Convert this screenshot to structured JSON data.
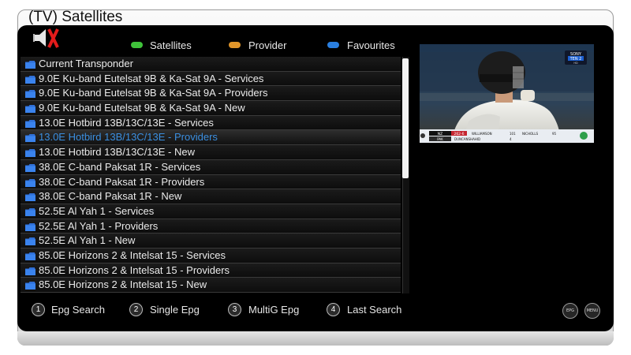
{
  "header": {
    "title": "(TV) Satellites"
  },
  "legend": {
    "satellites": {
      "label": "Satellites",
      "color": "#3fc23a"
    },
    "provider": {
      "label": "Provider",
      "color": "#e0952a"
    },
    "favourites": {
      "label": "Favourites",
      "color": "#2a7fe0"
    }
  },
  "list": {
    "selected_index": 5,
    "items": [
      "Current Transponder",
      "9.0E Ku-band Eutelsat 9B & Ka-Sat 9A - Services",
      "9.0E Ku-band Eutelsat 9B & Ka-Sat 9A - Providers",
      "9.0E Ku-band Eutelsat 9B & Ka-Sat 9A - New",
      "13.0E Hotbird 13B/13C/13E - Services",
      "13.0E Hotbird 13B/13C/13E - Providers",
      "13.0E Hotbird 13B/13C/13E - New",
      "38.0E C-band Paksat 1R - Services",
      "38.0E C-band Paksat 1R - Providers",
      "38.0E C-band Paksat 1R - New",
      "52.5E Al Yah 1 - Services",
      "52.5E Al Yah 1 - Providers",
      "52.5E Al Yah 1 - New",
      "85.0E Horizons 2 & Intelsat 15 - Services",
      "85.0E Horizons 2 & Intelsat 15 - Providers",
      "85.0E Horizons 2 & Intelsat 15 - New"
    ]
  },
  "footer": {
    "buttons": [
      {
        "num": "1",
        "label": "Epg Search"
      },
      {
        "num": "2",
        "label": "Single Epg"
      },
      {
        "num": "3",
        "label": "MultiG Epg"
      },
      {
        "num": "4",
        "label": "Last Search"
      }
    ],
    "epg_label": "EPG",
    "menu_label": "MENU"
  },
  "preview": {
    "channel_logo_line1": "SONY",
    "channel_logo_line2": "TEN 2",
    "channel_logo_line3": "HD",
    "score_team1": "NZ",
    "score1": "262-6",
    "batter1": "WILLIAMSON",
    "runs1": "101",
    "batter2": "NICHOLLS",
    "runs2": "95",
    "bowler": "ZUBEIR",
    "score_team2": "PAK",
    "team2_total": "BOWLING",
    "bowler_figures": "DUNCANSHAHID",
    "figures2": "4"
  }
}
